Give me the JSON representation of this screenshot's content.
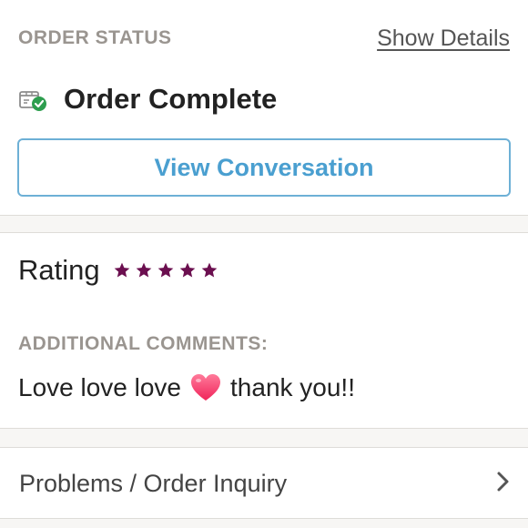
{
  "order_status": {
    "section_label": "ORDER STATUS",
    "show_details_label": "Show Details",
    "status_text": "Order Complete",
    "status_icon": "package-check-icon",
    "view_conversation_label": "View Conversation"
  },
  "rating": {
    "label": "Rating",
    "stars": 5,
    "max_stars": 5,
    "star_color": "#6b0f4f"
  },
  "comments": {
    "label": "ADDITIONAL COMMENTS:",
    "text_before": "Love love love",
    "emoji": "heart-icon",
    "text_after": "thank you!!"
  },
  "inquiry": {
    "label": "Problems / Order Inquiry",
    "icon": "chevron-right-icon"
  },
  "colors": {
    "accent_blue": "#4a9fd0",
    "button_border": "#6db0d6",
    "label_gray": "#9a9590",
    "check_green": "#2e9e4f",
    "heart_pink": "#ff3d6e"
  }
}
